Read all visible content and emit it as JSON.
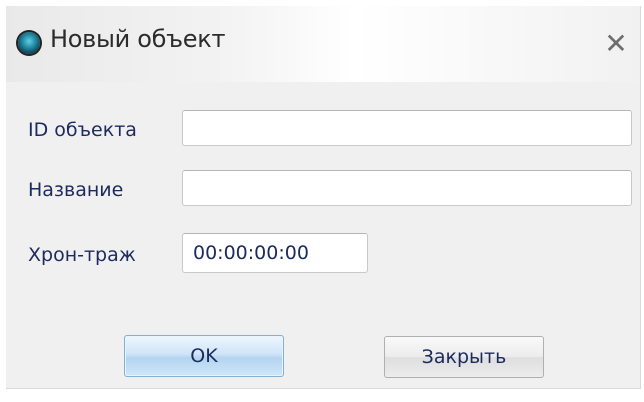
{
  "dialog": {
    "title": "Новый объект",
    "close_glyph": "✕",
    "icon": "app-orb-icon"
  },
  "fields": {
    "object_id": {
      "label": "ID объекта",
      "value": ""
    },
    "name": {
      "label": "Название",
      "value": ""
    },
    "chrono": {
      "label": "Хрон-траж",
      "value": "00:00:00:00"
    }
  },
  "buttons": {
    "ok_label": "OK",
    "close_label": "Закрыть"
  },
  "colors": {
    "label_text": "#1c2a5e",
    "ok_accent": "#b3d4f1",
    "dialog_bg": "#f0f0f0"
  }
}
